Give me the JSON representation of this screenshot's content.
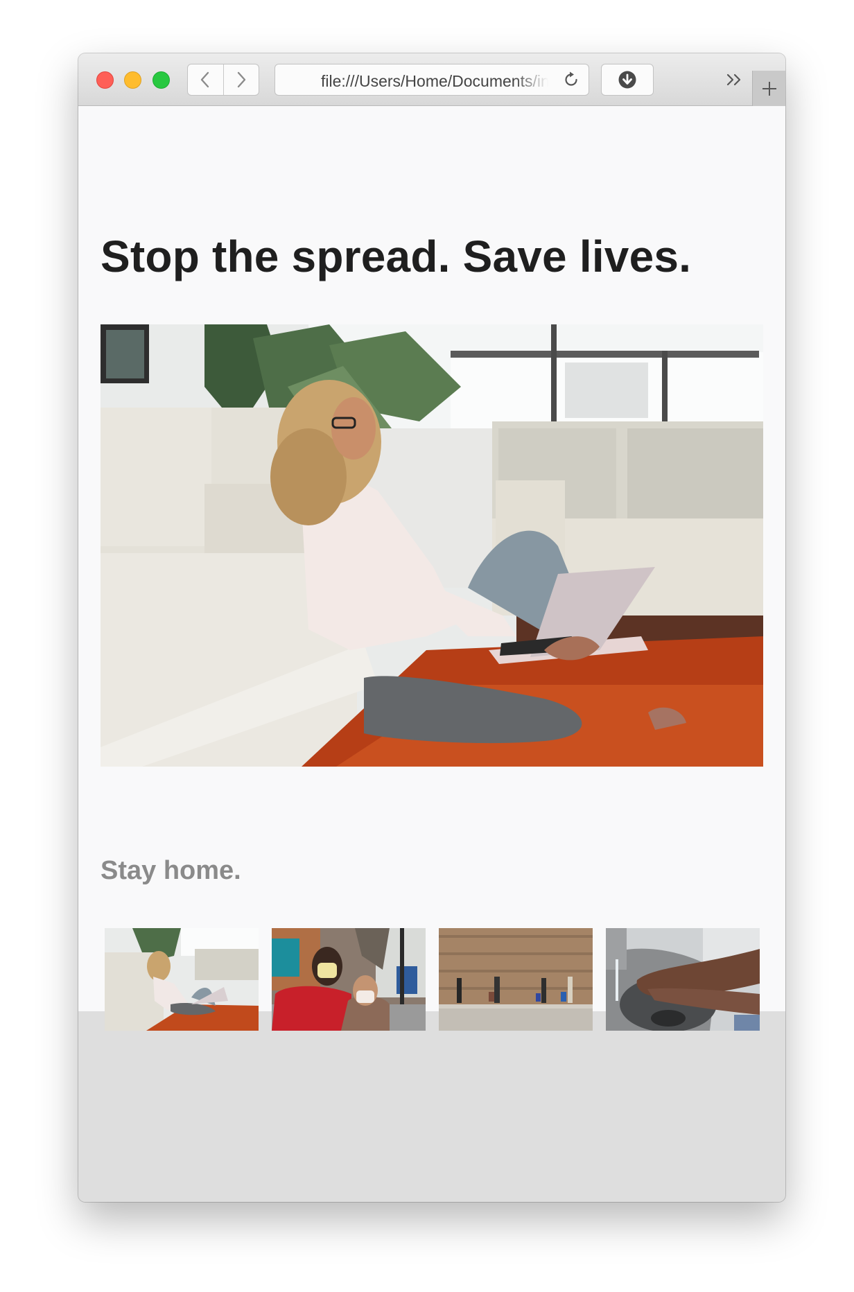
{
  "browser": {
    "address": "file:///Users/Home/Documents/index.html",
    "nav_icons": [
      "back-icon",
      "forward-icon"
    ],
    "toolbar_icons": [
      "reload-icon",
      "download-icon",
      "overflow-chevrons-icon",
      "new-tab-plus-icon"
    ]
  },
  "page": {
    "headline": "Stop the spread. Save lives.",
    "subhead": "Stay home."
  },
  "gallery": {
    "thumbnails": [
      "thumb-stay-home",
      "thumb-masks",
      "thumb-distancing",
      "thumb-handwashing"
    ]
  },
  "colors": {
    "page_background": "#f9f9fa",
    "headline": "#1f1f1f",
    "subhead": "#8a8a8a",
    "window_background": "#dedede"
  }
}
